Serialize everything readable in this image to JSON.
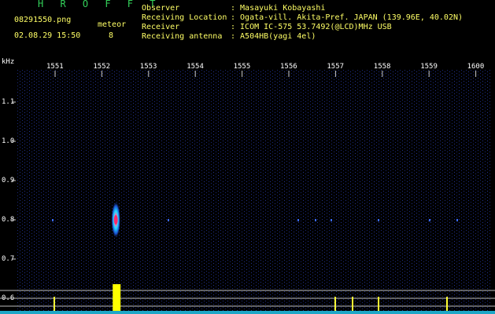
{
  "header": {
    "app_title": "H R O F F T",
    "filename": "08291550.png",
    "datetime": "02.08.29 15:50",
    "meteor_label": "meteor",
    "meteor_count": "8"
  },
  "info": {
    "observer_label": "Observer",
    "observer_value": ": Masayuki Kobayashi",
    "location_label": "Receiving Location",
    "location_value": ": Ogata-vill. Akita-Pref. JAPAN (139.96E, 40.02N)",
    "receiver_label": "Receiver",
    "receiver_value": ": ICOM IC-575 53.7492(@LCD)MHz USB",
    "antenna_label": "Receiving antenna",
    "antenna_value": ": A504HB(yagi 4el)"
  },
  "axes": {
    "y_unit": "kHz",
    "x_ticks": [
      "1551",
      "1552",
      "1553",
      "1554",
      "1555",
      "1556",
      "1557",
      "1558",
      "1559",
      "1600"
    ],
    "y_ticks": [
      "1.1",
      "1.0",
      "0.9",
      "0.8",
      "0.7",
      "0.6"
    ]
  },
  "chart_data": {
    "type": "heatmap",
    "title": "",
    "xlabel": "",
    "ylabel": "kHz",
    "x_ticks": [
      "1551",
      "1552",
      "1553",
      "1554",
      "1555",
      "1556",
      "1557",
      "1558",
      "1559",
      "1600"
    ],
    "y_ticks": [
      1.1,
      1.0,
      0.9,
      0.8,
      0.7,
      0.6
    ],
    "reference_line_khz": 0.8,
    "meteor_echoes": [
      {
        "time": "1552.3",
        "freq_khz": 0.8,
        "intensity": "strong"
      }
    ],
    "colors": {
      "background": "#000000",
      "noise": "#1a2a8a",
      "echo_core": "#ff3366",
      "echo_halo": "#00ccff",
      "bottom_trace": "#ffff00"
    }
  }
}
